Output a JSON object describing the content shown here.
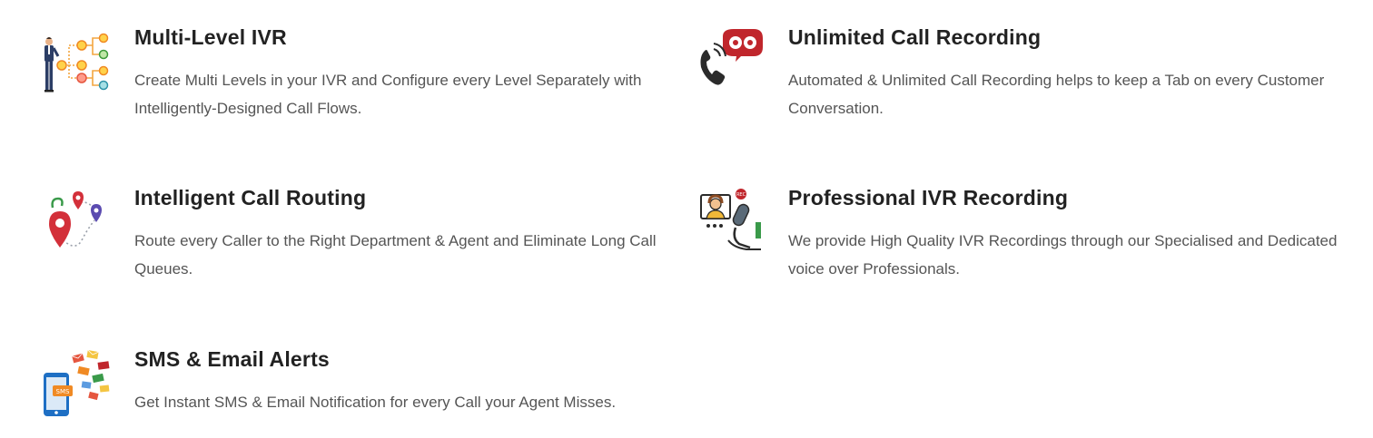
{
  "features": [
    {
      "icon": "ivr-flow-icon",
      "title": "Multi-Level IVR",
      "description": "Create Multi Levels in your IVR and Configure every Level Separately with Intelligently-Designed Call Flows."
    },
    {
      "icon": "call-recording-icon",
      "title": "Unlimited Call Recording",
      "description": "Automated & Unlimited Call Recording helps to keep a Tab on every Customer Conversation."
    },
    {
      "icon": "routing-pins-icon",
      "title": "Intelligent Call Routing",
      "description": "Route every Caller to the Right Department & Agent and Eliminate Long Call Queues."
    },
    {
      "icon": "voice-professional-icon",
      "title": "Professional IVR Recording",
      "description": "We provide High Quality IVR Recordings through our Specialised and Dedicated voice over Professionals."
    },
    {
      "icon": "sms-email-alert-icon",
      "title": "SMS & Email Alerts",
      "description": "Get Instant SMS & Email Notification for every Call your Agent Misses."
    }
  ],
  "icon_labels": {
    "recording_badge": "REC",
    "sms_badge": "SMS"
  },
  "colors": {
    "title": "#222222",
    "text": "#555555",
    "accent_red": "#c0262c",
    "accent_blue": "#1e6fc4"
  }
}
